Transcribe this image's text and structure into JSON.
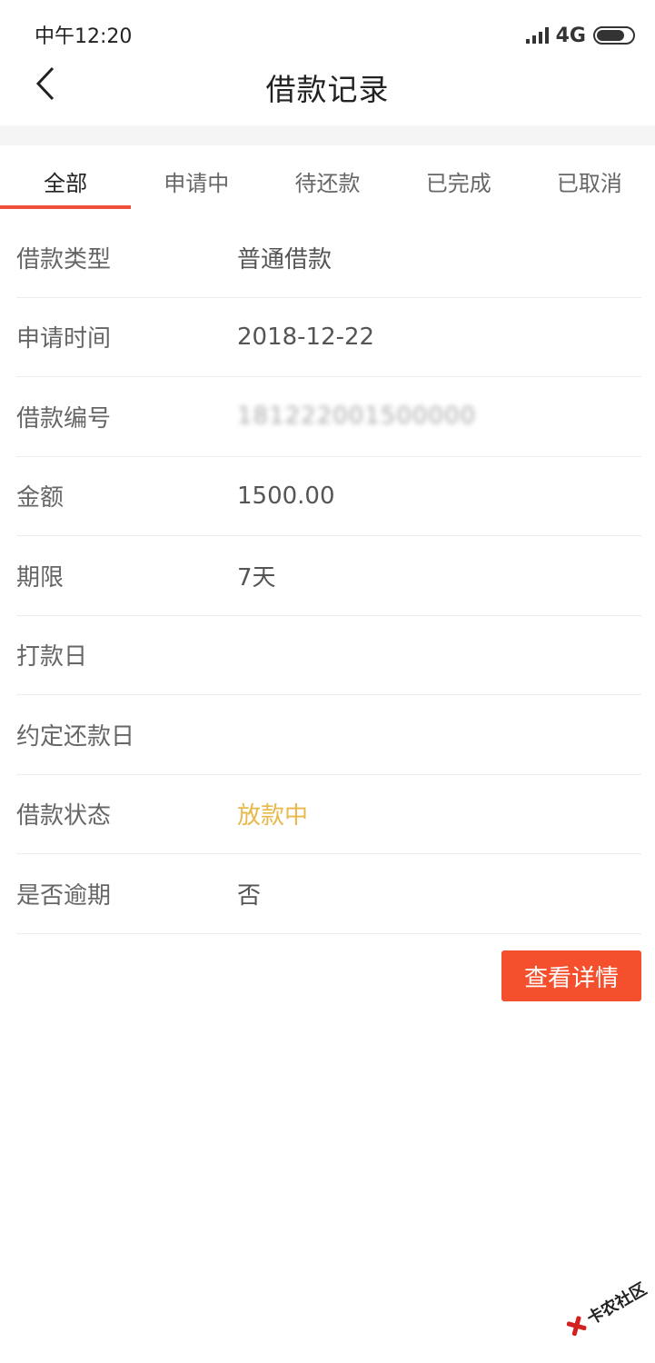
{
  "status_bar": {
    "time": "中午12:20",
    "network": "4G",
    "battery_level": 0.8
  },
  "header": {
    "back_icon": "chevron-left-icon",
    "title": "借款记录"
  },
  "tabs": [
    {
      "label": "全部",
      "active": true
    },
    {
      "label": "申请中",
      "active": false
    },
    {
      "label": "待还款",
      "active": false
    },
    {
      "label": "已完成",
      "active": false
    },
    {
      "label": "已取消",
      "active": false
    }
  ],
  "details": [
    {
      "label": "借款类型",
      "value": "普通借款"
    },
    {
      "label": "申请时间",
      "value": "2018-12-22"
    },
    {
      "label": "借款编号",
      "value": "181222001500000"
    },
    {
      "label": "金额",
      "value": "1500.00"
    },
    {
      "label": "期限",
      "value": "7天"
    },
    {
      "label": "打款日",
      "value": ""
    },
    {
      "label": "约定还款日",
      "value": ""
    },
    {
      "label": "借款状态",
      "value": "放款中"
    },
    {
      "label": "是否逾期",
      "value": "否"
    }
  ],
  "actions": {
    "view_detail": "查看详情"
  },
  "watermark": {
    "text": "卡农社区"
  },
  "colors": {
    "accent": "#f0503a",
    "button": "#f5502e",
    "status_pending": "#e8b84a"
  }
}
